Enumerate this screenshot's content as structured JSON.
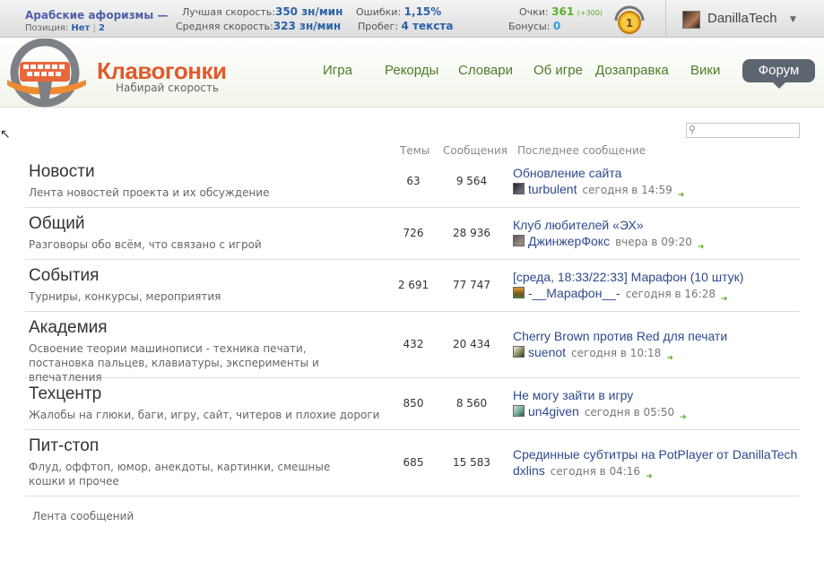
{
  "topbar": {
    "mode_title": "Арабские афоризмы —",
    "position_label": "Позиция:",
    "position_value": "Нет",
    "position_sep": "|",
    "position_num": "2",
    "best_speed_label": "Лучшая скорость:",
    "best_speed_value": "350 зн/мин",
    "avg_speed_label": "Средняя скорость:",
    "avg_speed_value": "323 зн/мин",
    "errors_label": "Ошибки:",
    "errors_value": "1,15%",
    "mileage_label": "Пробег:",
    "mileage_value": "4 текста",
    "points_label": "Очки:",
    "points_value": "361",
    "points_delta": "(+300)",
    "bonus_label": "Бонусы:",
    "bonus_value": "0",
    "level": "1",
    "username": "DanillaTech"
  },
  "header": {
    "logo_title": "Клавогонки",
    "logo_tagline": "Набирай скорость",
    "nav": [
      "Игра",
      "Рекорды",
      "Словари",
      "Об игре",
      "Дозаправка",
      "Вики"
    ],
    "nav_active": "Форум"
  },
  "columns": {
    "topics": "Темы",
    "messages": "Сообщения",
    "last_post": "Последнее сообщение"
  },
  "sections": [
    {
      "title": "Новости",
      "desc": "Лента новостей проекта и их обсуждение",
      "topics": "63",
      "messages": "9 564",
      "last_title": "Обновление сайта",
      "last_user": "turbulent",
      "last_time": "сегодня в 14:59"
    },
    {
      "title": "Общий",
      "desc": "Разговоры обо всём, что связано с игрой",
      "topics": "726",
      "messages": "28 936",
      "last_title": "Клуб любителей «ЭХ»",
      "last_user": "ДжинжерФокс",
      "last_time": "вчера в 09:20"
    },
    {
      "title": "События",
      "desc": "Турниры, конкурсы, мероприятия",
      "topics": "2 691",
      "messages": "77 747",
      "last_title": "[среда, 18:33/22:33] Марафон (10 штук)",
      "last_user": "-__Марафон__-",
      "last_time": "сегодня в 16:28"
    },
    {
      "title": "Академия",
      "desc": "Освоение теории машинописи - техника печати, постановка пальцев, клавиатуры, эксперименты и впечатления",
      "topics": "432",
      "messages": "20 434",
      "last_title": "Cherry Brown против Red для печати",
      "last_user": "suenot",
      "last_time": "сегодня в 10:18"
    },
    {
      "title": "Техцентр",
      "desc": "Жалобы на глюки, баги, игру, сайт, читеров и плохие дороги",
      "topics": "850",
      "messages": "8 560",
      "last_title": "Не могу зайти в игру",
      "last_user": "un4given",
      "last_time": "сегодня в 05:50"
    },
    {
      "title": "Пит-стоп",
      "desc": "Флуд, оффтоп, юмор, анекдоты, картинки, смешные кошки и прочее",
      "topics": "685",
      "messages": "15 583",
      "last_title": "Срединные субтитры на PotPlayer от DanillaTech",
      "last_user": "dxlins",
      "last_time": "сегодня в 04:16"
    }
  ],
  "footer": {
    "feed_link": "Лента сообщений"
  }
}
